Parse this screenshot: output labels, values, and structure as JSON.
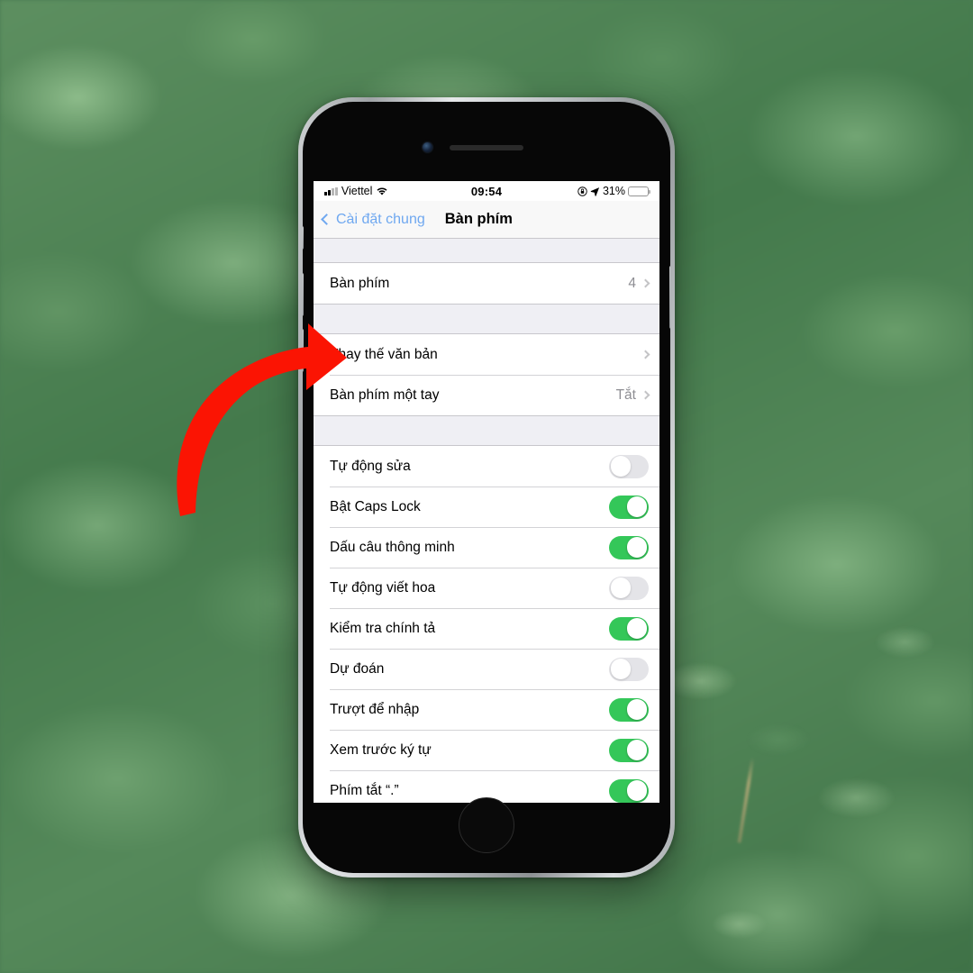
{
  "device": {
    "name": "iphone-7-plus-jet-black",
    "frame_color": "#9fa3a6"
  },
  "status_bar": {
    "signal_icon": "cellular-bars-icon",
    "carrier": "Viettel",
    "wifi_icon": "wifi-icon",
    "time": "09:54",
    "lock_icon": "rotation-lock-icon",
    "location_icon": "location-arrow-icon",
    "battery_percent": "31%",
    "battery_level": 31,
    "battery_color": "#f5c518"
  },
  "nav": {
    "back_icon": "chevron-left-icon",
    "back_label": "Cài đặt chung",
    "title": "Bàn phím",
    "tint": "#6fa8f0"
  },
  "groups": [
    {
      "rows": [
        {
          "label": "Bàn phím",
          "value": "4",
          "accessory": "chevron-right-icon"
        }
      ]
    },
    {
      "rows": [
        {
          "label": "Thay thế văn bản",
          "value": "",
          "accessory": "chevron-right-icon"
        },
        {
          "label": "Bàn phím một tay",
          "value": "Tắt",
          "accessory": "chevron-right-icon"
        }
      ]
    },
    {
      "rows": [
        {
          "label": "Tự động sửa",
          "accessory": "toggle",
          "on": false
        },
        {
          "label": "Bật Caps Lock",
          "accessory": "toggle",
          "on": true
        },
        {
          "label": "Dấu câu thông minh",
          "accessory": "toggle",
          "on": true
        },
        {
          "label": "Tự động viết hoa",
          "accessory": "toggle",
          "on": false
        },
        {
          "label": "Kiểm tra chính tả",
          "accessory": "toggle",
          "on": true
        },
        {
          "label": "Dự đoán",
          "accessory": "toggle",
          "on": false
        },
        {
          "label": "Trượt để nhập",
          "accessory": "toggle",
          "on": true
        },
        {
          "label": "Xem trước ký tự",
          "accessory": "toggle",
          "on": true
        },
        {
          "label": "Phím tắt “.”",
          "accessory": "toggle",
          "on": true
        }
      ]
    }
  ],
  "annotation": {
    "type": "curved-arrow",
    "color": "#fb1403",
    "points_at": "Thay thế văn bản"
  },
  "colors": {
    "toggle_on": "#34c759",
    "toggle_off": "#e4e4e8",
    "group_background": "#efeff4",
    "secondary_text": "#8e8e93"
  }
}
